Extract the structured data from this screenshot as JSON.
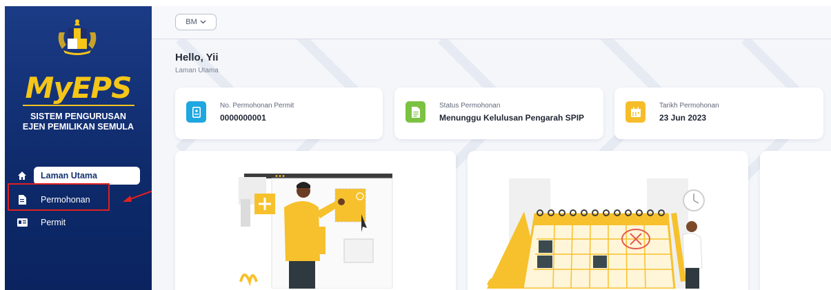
{
  "sidebar": {
    "brand": "MyEPS",
    "system_name_line1": "SISTEM PENGURUSAN",
    "system_name_line2": "EJEN PEMILIKAN SEMULA",
    "items": [
      {
        "label": "Laman Utama",
        "icon": "home-icon",
        "active": true
      },
      {
        "label": "Permohonan",
        "icon": "document-icon",
        "active": false
      },
      {
        "label": "Permit",
        "icon": "id-card-icon",
        "active": false
      }
    ]
  },
  "header": {
    "language": "BM"
  },
  "main": {
    "greeting": "Hello, Yii",
    "breadcrumb": "Laman Utama",
    "cards": [
      {
        "label": "No. Permohonan Permit",
        "value": "0000000001",
        "icon": "id-badge-icon",
        "color": "#1fa7e0"
      },
      {
        "label": "Status Permohonan",
        "value": "Menunggu Kelulusan Pengarah SPIP",
        "icon": "document-icon",
        "color": "#7cc242"
      },
      {
        "label": "Tarikh Permohonan",
        "value": "23 Jun 2023",
        "icon": "calendar-icon",
        "color": "#f6bd2a"
      }
    ]
  },
  "colors": {
    "sidebar": "#0e2a6a",
    "brand_yellow": "#f5c518",
    "highlight_red": "#e02020",
    "illustration_yellow": "#f6c12c"
  }
}
